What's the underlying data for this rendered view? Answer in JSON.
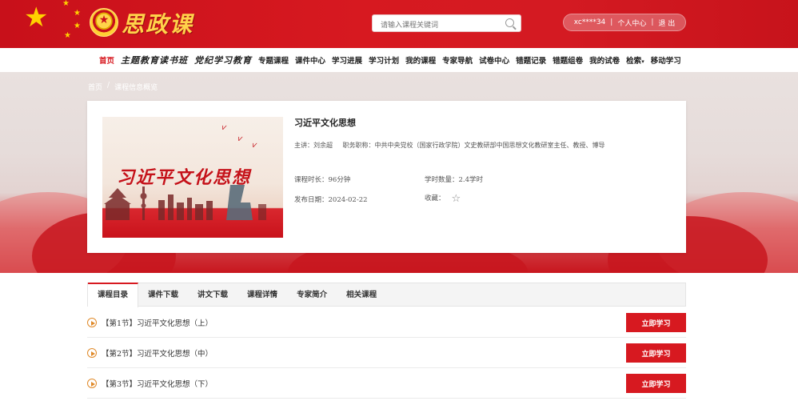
{
  "header": {
    "logo_text": "思政课",
    "search": {
      "placeholder": "请输入课程关键词"
    },
    "user": {
      "name": "xc****34",
      "profile_label": "个人中心",
      "logout_label": "退 出",
      "separator": "|"
    }
  },
  "nav": {
    "items": [
      {
        "label": "首页",
        "active": true,
        "script": false
      },
      {
        "label": "主题教育读书班",
        "active": false,
        "script": true
      },
      {
        "label": "党纪学习教育",
        "active": false,
        "script": true
      },
      {
        "label": "专题课程",
        "active": false,
        "script": false
      },
      {
        "label": "课件中心",
        "active": false,
        "script": false
      },
      {
        "label": "学习进展",
        "active": false,
        "script": false
      },
      {
        "label": "学习计划",
        "active": false,
        "script": false
      },
      {
        "label": "我的课程",
        "active": false,
        "script": false
      },
      {
        "label": "专家导航",
        "active": false,
        "script": false
      },
      {
        "label": "试卷中心",
        "active": false,
        "script": false
      },
      {
        "label": "错题记录",
        "active": false,
        "script": false
      },
      {
        "label": "错题组卷",
        "active": false,
        "script": false
      },
      {
        "label": "我的试卷",
        "active": false,
        "script": false
      },
      {
        "label": "检索",
        "active": false,
        "script": false,
        "dropdown": true
      },
      {
        "label": "移动学习",
        "active": false,
        "script": false
      }
    ]
  },
  "breadcrumb": {
    "home": "首页",
    "separator": "/",
    "current": "课程信息概览"
  },
  "course": {
    "thumbnail_title": "习近平文化思想",
    "title": "习近平文化思想",
    "teacher_label": "主讲：刘余超",
    "position_label": "职务职称：中共中央党校（国家行政学院）文史教研部中国思想文化教研室主任、教授、博导",
    "duration_label": "课程时长：96分钟",
    "credits_label": "学时数量：2.4学时",
    "publish_label": "发布日期：2024-02-22",
    "favorite_label": "收藏："
  },
  "tabs": [
    {
      "label": "课程目录",
      "active": true
    },
    {
      "label": "课件下载",
      "active": false
    },
    {
      "label": "讲文下载",
      "active": false
    },
    {
      "label": "课程详情",
      "active": false
    },
    {
      "label": "专家简介",
      "active": false
    },
    {
      "label": "相关课程",
      "active": false
    }
  ],
  "lessons": [
    {
      "title": "【第1节】习近平文化思想（上）",
      "button": "立即学习"
    },
    {
      "title": "【第2节】习近平文化思想（中）",
      "button": "立即学习"
    },
    {
      "title": "【第3节】习近平文化思想（下）",
      "button": "立即学习"
    }
  ],
  "colors": {
    "primary_red": "#d71920",
    "gold": "#ffd200",
    "play_orange": "#e08a2a"
  }
}
